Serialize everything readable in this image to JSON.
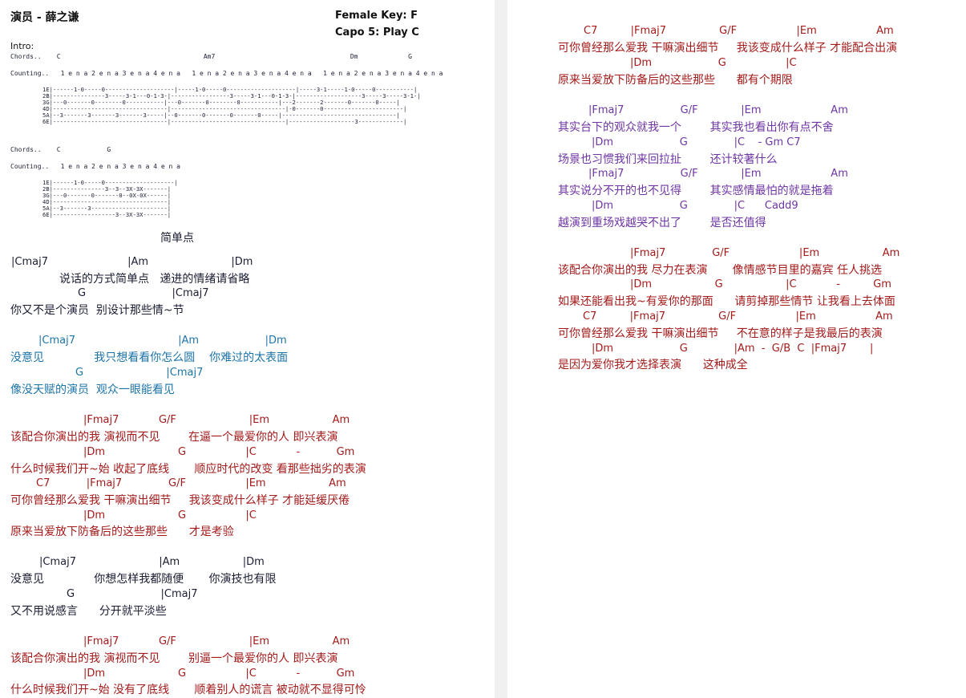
{
  "header": {
    "title": "演员 - 薛之谦",
    "key": "Female Key: F",
    "capo": "Capo 5: Play C"
  },
  "intro": {
    "label": "Intro:",
    "chords_line_1": "Chords..    C                                     Am7                                   Dm             G",
    "counting_line_1": "Counting..   1 e n a 2 e n a 3 e n a 4 e n a   1 e n a 2 e n a 3 e n a 4 e n a   1 e n a 2 e n a 3 e n a 4 e n a",
    "tab_1": [
      "1E|------1-0-----0--------------------|-----1-0-----0--------------------|-----3-1-----1-0-----0-----------|",
      "2B|---------------3-----3-1---0-1-3-|-----------------3-----3-1---0-1-3-|-------------------3-----3-----3-1-|",
      "3G|---0-------0--------0-----------|---0-------0--------0-----------|---2-------2-------0-------0-----|",
      "4D|---------------------------------|---------------------------------|-0-------0-----------------------|",
      "5A|--3-------3-------3-------3-----|--0-------0-------0-------0-----|---------------------------------|",
      "6E|---------------------------------|---------------------------------|-------------------3-------------|"
    ],
    "chords_line_2": "Chords..    C            G",
    "counting_line_2": "Counting..   1 e n a 2 e n a 3 e n a 4 e n a",
    "tab_2": [
      "1E|------1-0-----0--------------------|",
      "2B|---------------3--3--3X-3X-------|",
      "3G|---0-------0-------0--0X-0X------|",
      "4D|---------------------------------|",
      "5A|--3-------3----------------------|",
      "6E|------------------3--3X-3X-------|"
    ]
  },
  "left_lines": [
    "简单点",
    "|Cmaj7                        |Am                         |Dm",
    "说话的方式简单点   递进的情绪请省略",
    "G                          |Cmaj7",
    "你又不是个演员  别设计那些情~节",
    "|Cmaj7                               |Am                    |Dm",
    "没意见              我只想看看你怎么圆    你难过的太表面",
    "G                         |Cmaj7",
    "像没天赋的演员  观众一眼能看见",
    "|Fmaj7            G/F                      |Em                   Am",
    "该配合你演出的我 演视而不见        在逼一个最爱你的人 即兴表演",
    "|Dm                      G                  |C            -           Gm",
    "什么时候我们开~始 收起了底线       顺应时代的改变 看那些拙劣的表演",
    "C7           |Fmaj7              G/F                  |Em                   Am",
    "可你曾经那么爱我 干嘛演出细节     我该变成什么样子 才能延缓厌倦",
    "|Dm                      G                  |C",
    "原来当爱放下防备后的这些那些      才是考验",
    "|Cmaj7                         |Am                   |Dm",
    "没意见              你想怎样我都随便       你演技也有限",
    "G                          |Cmaj7",
    "又不用说感言      分开就平淡些",
    "|Fmaj7            G/F                      |Em                   Am",
    "该配合你演出的我 演视而不见        别逼一个最爱你的人 即兴表演",
    "|Dm                      G                  |C            -           Gm",
    "什么时候我们开~始 没有了底线       顺着别人的谎言 被动就不显得可怜"
  ],
  "right_lines": [
    "C7          |Fmaj7                G/F                  |Em                  Am",
    "可你曾经那么爱我 干嘛演出细节     我该变成什么样子 才能配合出演",
    "|Dm                    G                  |C",
    "原来当爱放下防备后的这些那些      都有个期限",
    "|Fmaj7                 G/F             |Em                     Am",
    "其实台下的观众就我一个        其实我也看出你有点不舍",
    "|Dm                    G              |C    - Gm C7",
    "场景也习惯我们来回拉扯        还计较著什么",
    "|Fmaj7                 G/F             |Em                     Am",
    "其实说分不开的也不见得        其实感情最怕的就是拖着",
    "|Dm                    G              |C      Cadd9",
    "越演到重场戏越哭不出了        是否还值得",
    "|Fmaj7              G/F                     |Em                   Am",
    "该配合你演出的我 尽力在表演       像情感节目里的嘉宾 任人挑选",
    "|Dm                   G                   |C            -          Gm",
    "如果还能看出我~有爱你的那面      请剪掉那些情节 让我看上去体面",
    "C7          |Fmaj7                G/F                  |Em                  Am",
    "可你曾经那么爱我 干嘛演出细节     不在意的样子是我最后的表演",
    "|Dm                    G              |Am  -  G/B  C  |Fmaj7       |",
    "是因为爱你我才选择表演      这种成全"
  ],
  "colors": {
    "dark": "#1b1e33",
    "blue": "#1d74a8",
    "red": "#a31a1a",
    "purple": "#6e35a3"
  }
}
